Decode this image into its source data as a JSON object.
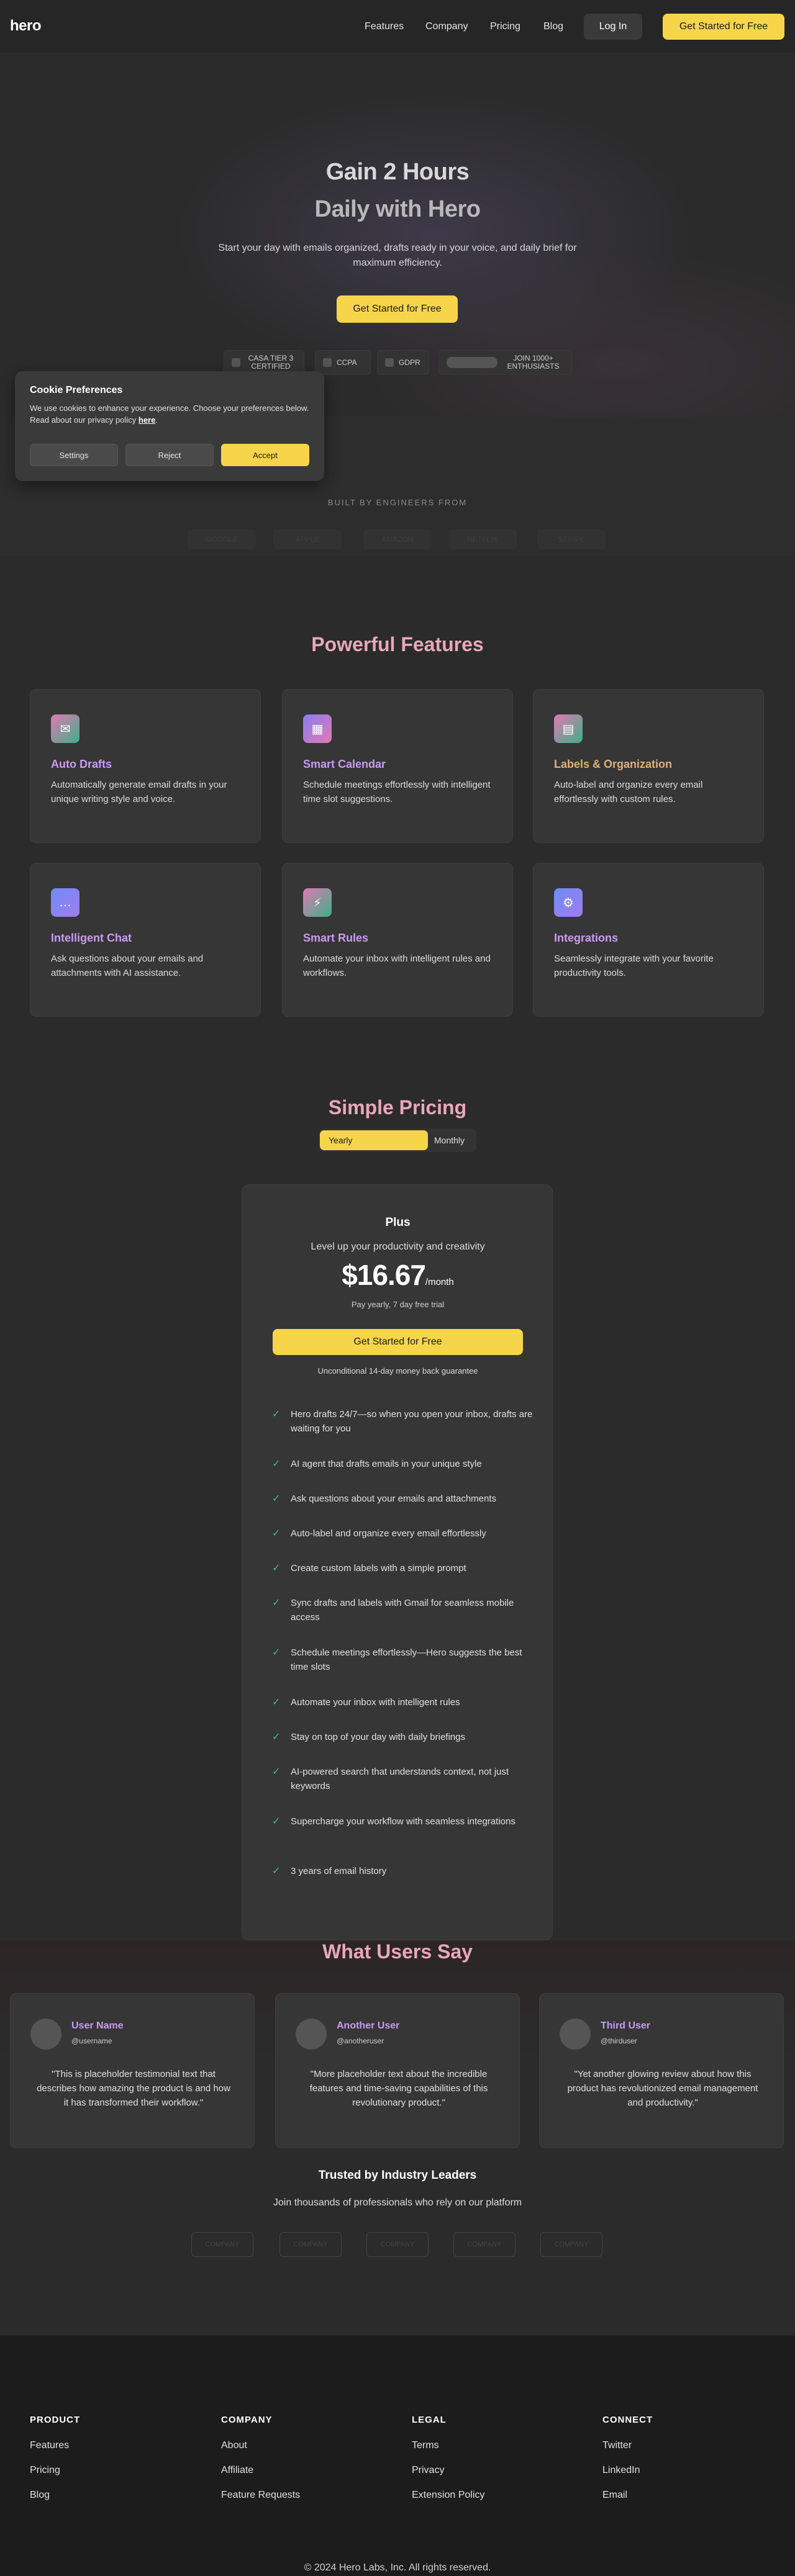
{
  "nav": {
    "logo": "hero",
    "links": [
      "Features",
      "Company",
      "Pricing",
      "Blog"
    ],
    "login": "Log In",
    "cta": "Get Started for Free"
  },
  "hero": {
    "title_line1": "Gain 2 Hours",
    "title_line2": "Daily with Hero",
    "subtitle": "Start your day with emails organized, drafts ready in your voice, and daily brief for maximum efficiency.",
    "cta": "Get Started for Free",
    "badges": [
      "CASA TIER 3 CERTIFIED",
      "CCPA",
      "GDPR"
    ],
    "join": "JOIN 1000+ ENTHUSIASTS"
  },
  "built_by": {
    "title": "BUILT BY ENGINEERS FROM",
    "logos": [
      "GOOGLE",
      "APPLE",
      "AMAZON",
      "NETFLIX",
      "STRIPE"
    ]
  },
  "cookie": {
    "title": "Cookie Preferences",
    "text": "We use cookies to enhance your experience. Choose your preferences below. Read about our privacy policy",
    "link": "here",
    "settings": "Settings",
    "reject": "Reject",
    "accept": "Accept"
  },
  "features": {
    "title": "Powerful Features",
    "items": [
      {
        "title": "Auto Drafts",
        "desc": "Automatically generate email drafts in your unique writing style and voice.",
        "icon": "envelope-icon",
        "glyph": "✉"
      },
      {
        "title": "Smart Calendar",
        "desc": "Schedule meetings effortlessly with intelligent time slot suggestions.",
        "icon": "calendar-icon",
        "glyph": "▦"
      },
      {
        "title": "Labels & Organization",
        "desc": "Auto-label and organize every email effortlessly with custom rules.",
        "icon": "label-icon",
        "glyph": "▤"
      },
      {
        "title": "Intelligent Chat",
        "desc": "Ask questions about your emails and attachments with AI assistance.",
        "icon": "chat-icon",
        "glyph": "…"
      },
      {
        "title": "Smart Rules",
        "desc": "Automate your inbox with intelligent rules and workflows.",
        "icon": "lightning-icon",
        "glyph": "⚡"
      },
      {
        "title": "Integrations",
        "desc": "Seamlessly integrate with your favorite productivity tools.",
        "icon": "plug-icon",
        "glyph": "⚙"
      }
    ]
  },
  "pricing": {
    "title": "Simple Pricing",
    "toggle": {
      "yearly": "Yearly",
      "monthly": "Monthly"
    },
    "plan": {
      "name": "Plus",
      "tagline": "Level up your productivity and creativity",
      "price": "$16.67",
      "period": "/month",
      "note": "Pay yearly, 7 day free trial",
      "cta": "Get Started for Free",
      "guarantee": "Unconditional 14-day money back guarantee",
      "features": [
        "Hero drafts 24/7—so when you open your inbox, drafts are waiting for you",
        "AI agent that drafts emails in your unique style",
        "Ask questions about your emails and attachments",
        "Auto-label and organize every email effortlessly",
        "Create custom labels with a simple prompt",
        "Sync drafts and labels with Gmail for seamless mobile access",
        "Schedule meetings effortlessly—Hero suggests the best time slots",
        "Automate your inbox with intelligent rules",
        "Stay on top of your day with daily briefings",
        "AI-powered search that understands context, not just keywords",
        "Supercharge your workflow with seamless integrations",
        "3 years of email history"
      ]
    }
  },
  "testimonials": {
    "title": "What Users Say",
    "items": [
      {
        "name": "User Name",
        "handle": "@username",
        "quote": "\"This is placeholder testimonial text that describes how amazing the product is and how it has transformed their workflow.\""
      },
      {
        "name": "Another User",
        "handle": "@anotheruser",
        "quote": "\"More placeholder text about the incredible features and time-saving capabilities of this revolutionary product.\""
      },
      {
        "name": "Third User",
        "handle": "@thirduser",
        "quote": "\"Yet another glowing review about how this product has revolutionized email management and productivity.\""
      }
    ],
    "trusted_title": "Trusted by Industry Leaders",
    "trusted_sub": "Join thousands of professionals who rely on our platform",
    "trusted_logos": [
      "COMPANY",
      "COMPANY",
      "COMPANY",
      "COMPANY",
      "COMPANY"
    ]
  },
  "footer": {
    "columns": [
      {
        "head": "PRODUCT",
        "links": [
          "Features",
          "Pricing",
          "Blog"
        ]
      },
      {
        "head": "COMPANY",
        "links": [
          "About",
          "Affiliate",
          "Feature Requests"
        ]
      },
      {
        "head": "LEGAL",
        "links": [
          "Terms",
          "Privacy",
          "Extension Policy"
        ]
      },
      {
        "head": "CONNECT",
        "links": [
          "Twitter",
          "LinkedIn",
          "Email"
        ]
      }
    ],
    "copyright": "© 2024 Hero Labs, Inc. All rights reserved."
  },
  "colors": {
    "accent": "#f6d54a",
    "feature_title": "#c99bf2",
    "section_title": "#e8a8b8",
    "check": "#3fbf7f"
  }
}
